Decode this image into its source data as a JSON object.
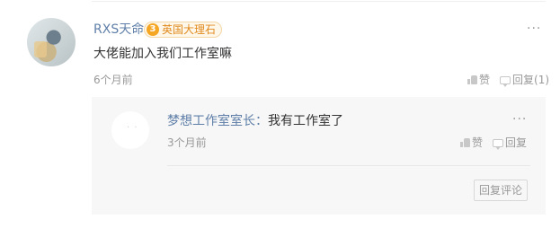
{
  "comment": {
    "username": "RXS天命",
    "badge": {
      "number": "3",
      "label": "英国大理石"
    },
    "more_label": "···",
    "content": "大佬能加入我们工作室嘛",
    "time": "6个月前",
    "like_label": "赞",
    "reply_label": "回复",
    "reply_count_label": "(1)"
  },
  "reply": {
    "avatar_glyph": "· ·",
    "username": "梦想工作室室长",
    "separator": "：",
    "content": "我有工作室了",
    "time": "3个月前",
    "more_label": "···",
    "like_label": "赞",
    "reply_label": "回复",
    "reply_comment_button": "回复评论"
  },
  "colors": {
    "link_blue": "#5f7fa8",
    "badge_orange": "#f5a623",
    "muted_text": "#999999",
    "reply_background": "#f7f7f7"
  },
  "icons": {
    "like": "thumbs-up-icon",
    "reply": "speech-bubble-icon",
    "badge": "level-3-medal-icon",
    "more": "more-dots-icon"
  }
}
